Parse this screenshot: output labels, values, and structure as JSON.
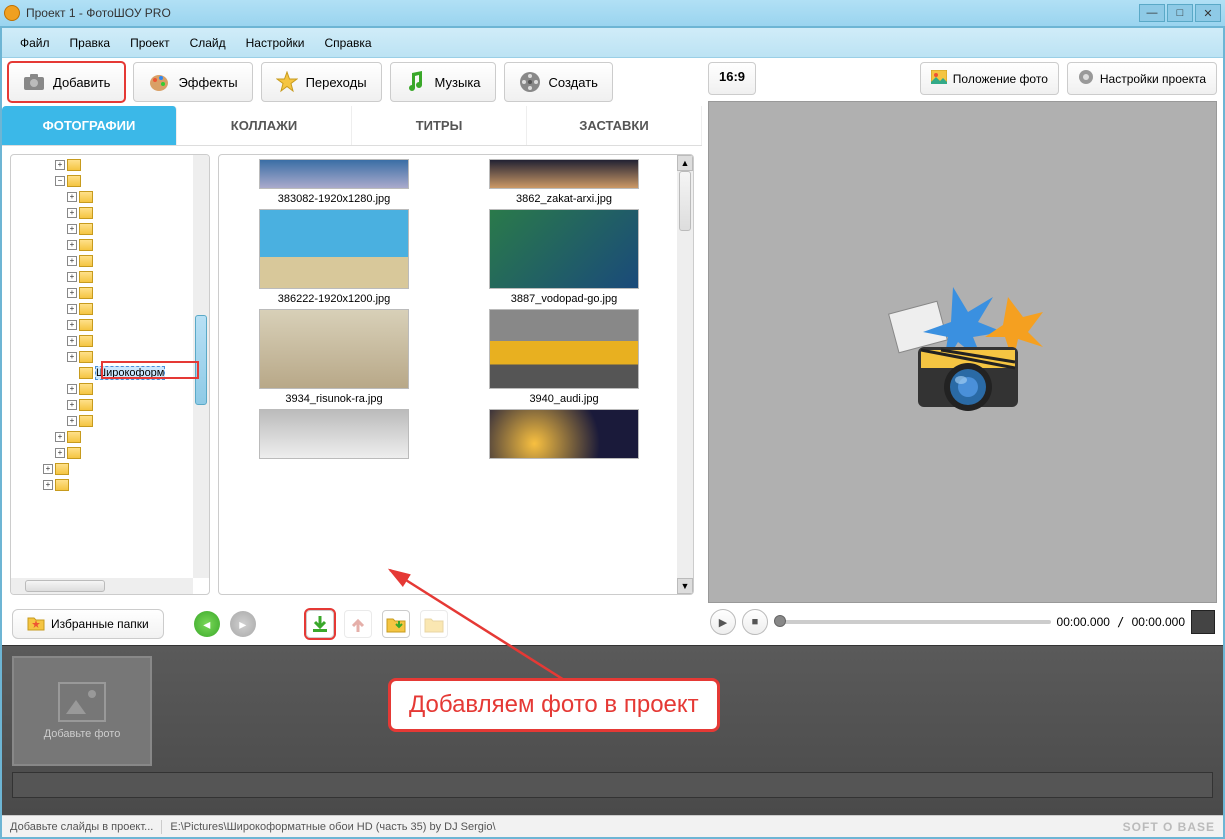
{
  "window": {
    "title": "Проект 1 - ФотоШОУ PRO"
  },
  "menu": {
    "file": "Файл",
    "edit": "Правка",
    "project": "Проект",
    "slide": "Слайд",
    "settings": "Настройки",
    "help": "Справка"
  },
  "toolbar": {
    "add": "Добавить",
    "effects": "Эффекты",
    "transitions": "Переходы",
    "music": "Музыка",
    "create": "Создать"
  },
  "tabs": {
    "photos": "ФОТОГРАФИИ",
    "collages": "КОЛЛАЖИ",
    "titles": "ТИТРЫ",
    "intros": "ЗАСТАВКИ"
  },
  "tree": {
    "selected": "Широкоформ"
  },
  "thumbs": {
    "t1": "383082-1920x1280.jpg",
    "t2": "3862_zakat-arxi.jpg",
    "t3": "386222-1920x1200.jpg",
    "t4": "3887_vodopad-go.jpg",
    "t5": "3934_risunok-ra.jpg",
    "t6": "3940_audi.jpg"
  },
  "actions": {
    "favorites": "Избранные папки"
  },
  "rightpanel": {
    "aspect": "16:9",
    "photo_position": "Положение фото",
    "project_settings": "Настройки проекта",
    "time_current": "00:00.000",
    "time_total": "00:00.000"
  },
  "timeline": {
    "placeholder": "Добавьте фото"
  },
  "statusbar": {
    "hint": "Добавьте слайды в проект...",
    "path": "E:\\Pictures\\Широкоформатные обои HD (часть 35) by DJ Sergio\\",
    "brand": "SOFT O BASE"
  },
  "annotation": {
    "text": "Добавляем фото в проект"
  }
}
